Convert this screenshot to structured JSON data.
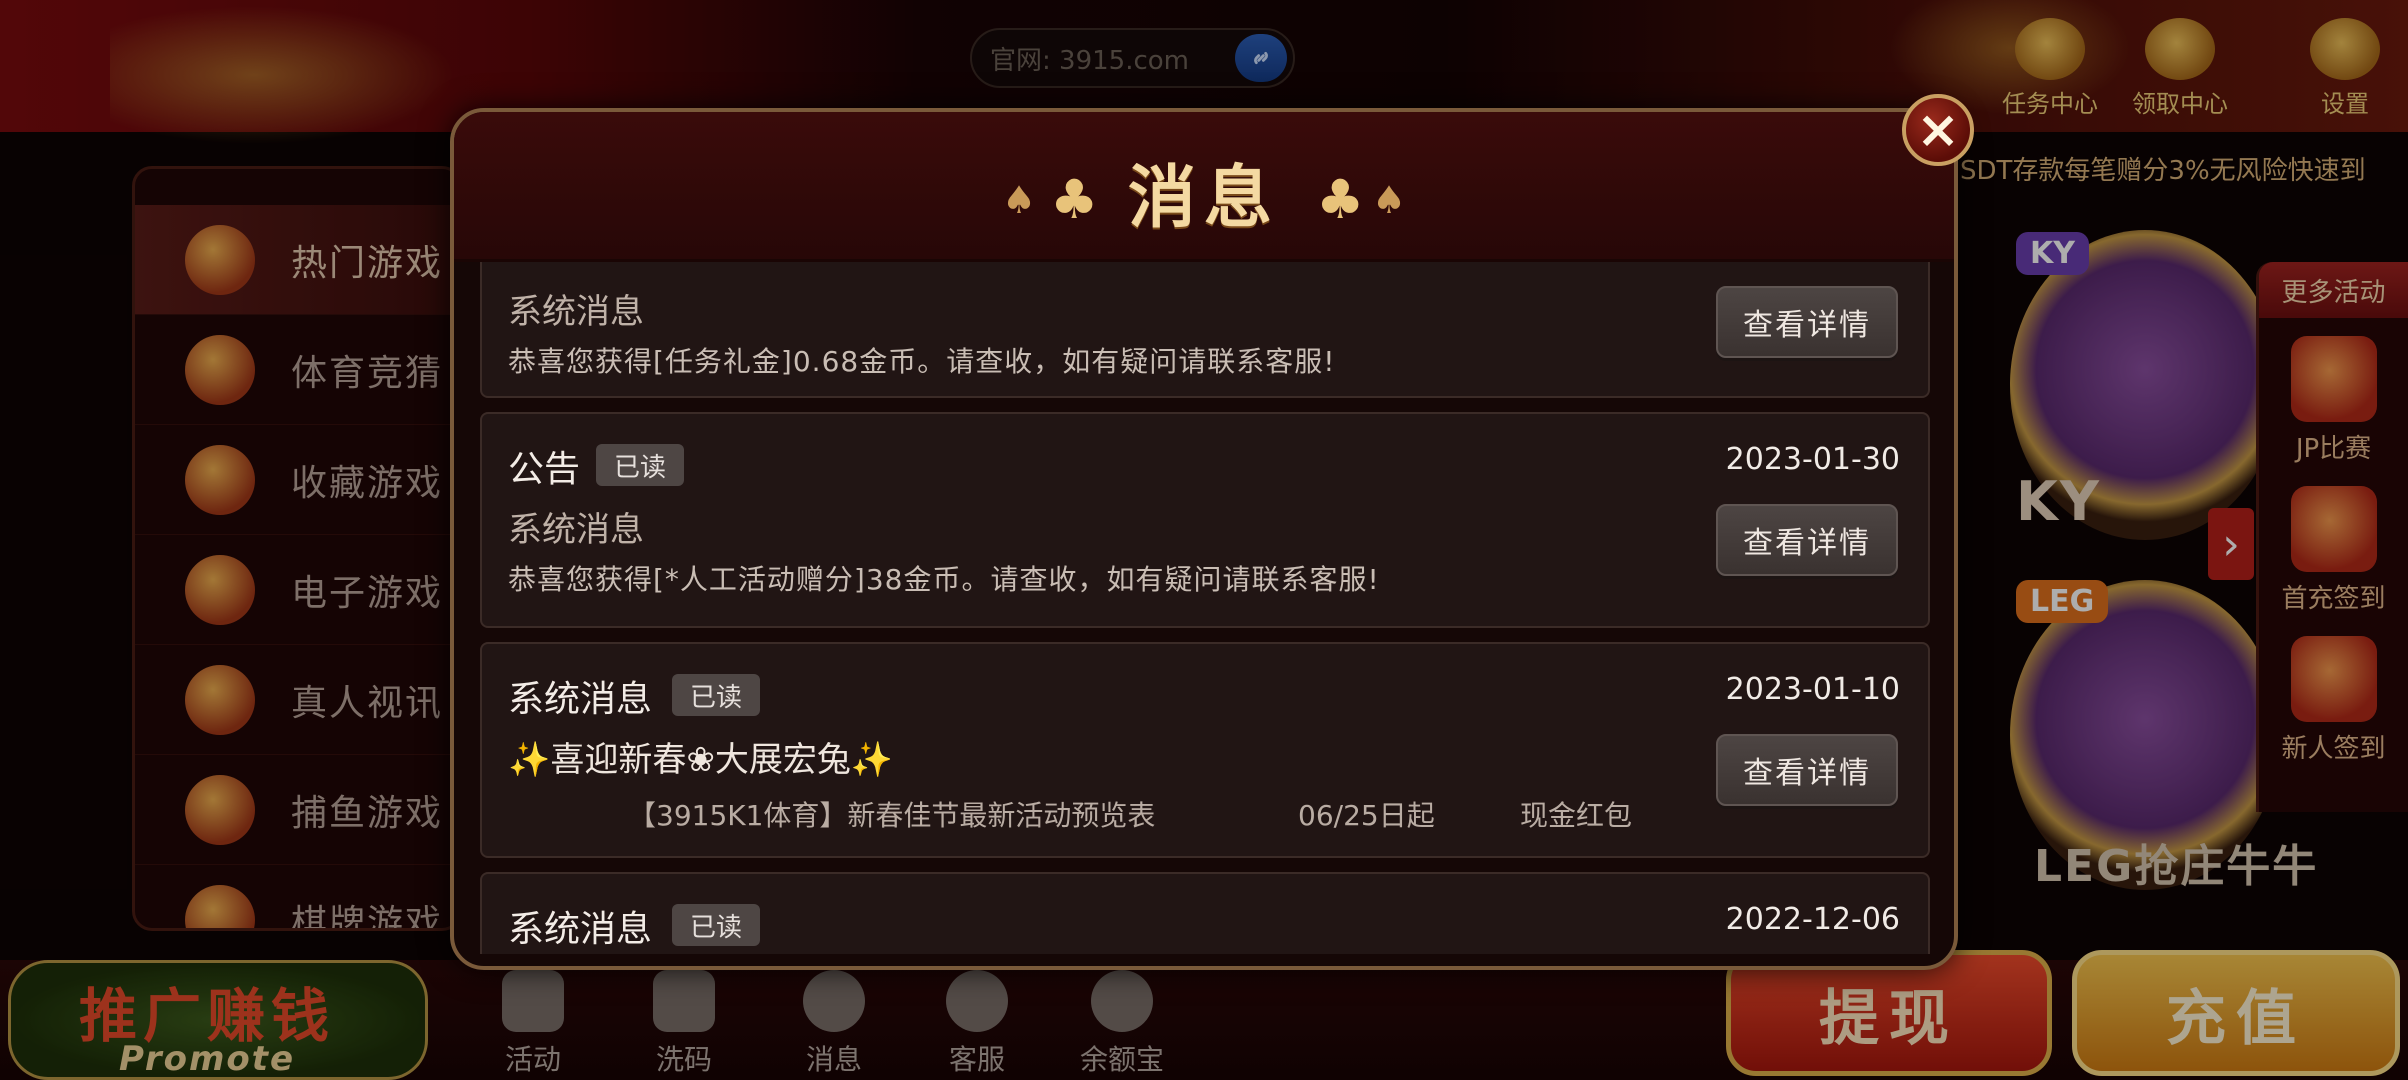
{
  "top": {
    "url_text": "官网: 3915.com",
    "icons": [
      {
        "label": "任务中心",
        "icon": "task-icon"
      },
      {
        "label": "领取中心",
        "icon": "lion-icon"
      },
      {
        "label": "设置",
        "icon": "gear-icon"
      }
    ],
    "marquee": "SDT存款每笔赠分3%无风险快速到"
  },
  "sidebar": {
    "items": [
      {
        "label": "热门游戏",
        "icon": "hot-icon"
      },
      {
        "label": "体育竞猜",
        "icon": "soccer-icon"
      },
      {
        "label": "收藏游戏",
        "icon": "heart-icon"
      },
      {
        "label": "电子游戏",
        "icon": "slot-icon"
      },
      {
        "label": "真人视讯",
        "icon": "roulette-icon"
      },
      {
        "label": "捕鱼游戏",
        "icon": "fish-icon"
      },
      {
        "label": "棋牌游戏",
        "icon": "cards-icon"
      }
    ]
  },
  "games": {
    "ky_tag": "KY",
    "ky_label": "KY",
    "leg_tag": "LEG",
    "leg_label": "LEG抢庄牛牛"
  },
  "more_activities": {
    "title": "更多活动",
    "items": [
      {
        "label": "JP比赛"
      },
      {
        "label": "首充签到"
      },
      {
        "label": "新人签到"
      }
    ]
  },
  "bottom": {
    "promote_cn": "推广赚钱",
    "promote_en": "Promote",
    "nav": [
      {
        "label": "活动",
        "icon": "gift-icon"
      },
      {
        "label": "洗码",
        "icon": "chips-icon"
      },
      {
        "label": "消息",
        "icon": "chat-icon"
      },
      {
        "label": "客服",
        "icon": "headset-icon"
      },
      {
        "label": "余额宝",
        "icon": "ingot-icon"
      }
    ],
    "withdraw": "提现",
    "recharge": "充值"
  },
  "modal": {
    "title": "消息",
    "close": "×",
    "detail_label": "查看详情",
    "messages": [
      {
        "type": "",
        "badge": "",
        "date": "",
        "subject": "系统消息",
        "body": "恭喜您获得[任务礼金]0.68金币。请查收，如有疑问请联系客服!"
      },
      {
        "type": "公告",
        "badge": "已读",
        "date": "2023-01-30",
        "subject": "系统消息",
        "body": "恭喜您获得[*人工活动赠分]38金币。请查收，如有疑问请联系客服!"
      },
      {
        "type": "系统消息",
        "badge": "已读",
        "date": "2023-01-10",
        "subject": "✨喜迎新春❀大展宏兔✨",
        "promo": [
          "【3915K1体育】新春佳节最新活动预览表",
          "06/25日起",
          "现金红包"
        ]
      },
      {
        "type": "系统消息",
        "badge": "已读",
        "date": "2022-12-06"
      }
    ]
  },
  "colors": {
    "accent_gold": "#f4d9a2",
    "card_bg": "#211514",
    "button_bg": "#4d4543",
    "withdraw_red": "#f04c2c",
    "recharge_gold": "#f7c64f"
  }
}
